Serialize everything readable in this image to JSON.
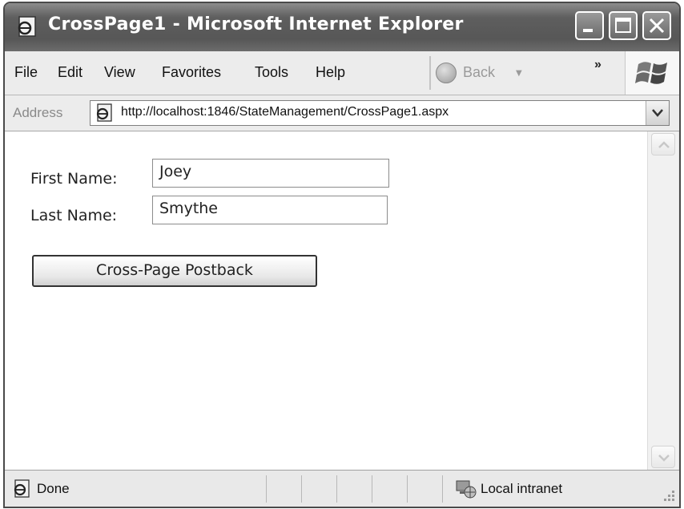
{
  "window": {
    "title": "CrossPage1 - Microsoft Internet Explorer"
  },
  "menu": {
    "items": [
      "File",
      "Edit",
      "View",
      "Favorites",
      "Tools",
      "Help"
    ],
    "back_label": "Back",
    "more": "»"
  },
  "address": {
    "label": "Address",
    "url": "http://localhost:1846/StateManagement/CrossPage1.aspx"
  },
  "form": {
    "first_name_label": "First Name:",
    "first_name_value": "Joey",
    "last_name_label": "Last Name:",
    "last_name_value": "Smythe",
    "submit_label": "Cross-Page Postback"
  },
  "status": {
    "text": "Done",
    "zone": "Local intranet"
  },
  "icons": {
    "page": "ie-page-icon",
    "back": "back-arrow-icon",
    "logo": "windows-logo-icon",
    "zone": "intranet-icon"
  }
}
